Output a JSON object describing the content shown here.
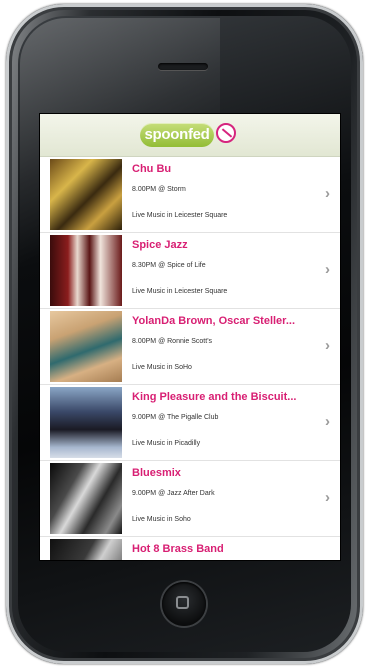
{
  "app": {
    "logo_text": "spoonfed",
    "accent_color": "#d81f73",
    "brand_color": "#92bd35"
  },
  "events": [
    {
      "title": "Chu Bu",
      "time_venue": "8.00PM @ Storm",
      "location": "Live Music in Leicester Square"
    },
    {
      "title": "Spice Jazz",
      "time_venue": "8.30PM @ Spice of Life",
      "location": "Live Music in Leicester Square"
    },
    {
      "title": "YolanDa Brown, Oscar Steller...",
      "time_venue": "8.00PM @ Ronnie Scott's",
      "location": "Live Music in SoHo"
    },
    {
      "title": "King Pleasure and the Biscuit...",
      "time_venue": "9.00PM @ The Pigalle Club",
      "location": "Live Music in Picadilly"
    },
    {
      "title": "Bluesmix",
      "time_venue": "9.00PM @ Jazz After Dark",
      "location": "Live Music in Soho"
    },
    {
      "title": "Hot 8 Brass Band",
      "time_venue": "",
      "location": ""
    }
  ],
  "icons": {
    "chevron": "›",
    "row_disclosure": "chevron-right-icon",
    "logo_badge": "no-sign-icon",
    "home": "home-button-icon"
  }
}
